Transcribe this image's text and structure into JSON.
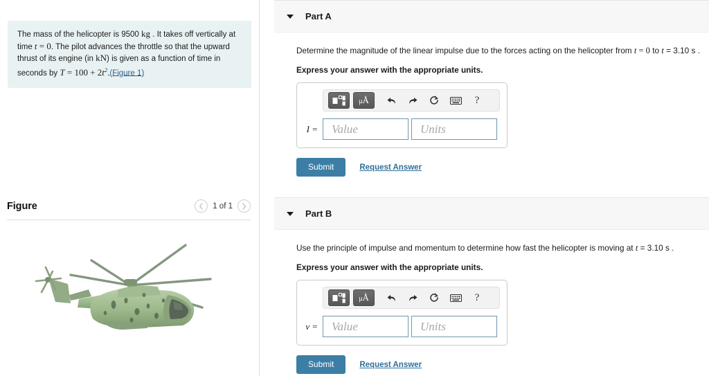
{
  "problem": {
    "text_part1": "The mass of the helicopter is 9500 ",
    "unit_kg": "kg",
    "text_part2": " . It takes off vertically at time ",
    "var_t": "t",
    "eq0": " = 0",
    "text_part3": ". The pilot advances the throttle so that the upward thrust of its engine (in ",
    "unit_kn": "kN",
    "text_part4": ") is given as a function of time in seconds by ",
    "var_T": "T",
    "formula": " = 100 + 2",
    "formula_var": "t",
    "formula_exp": "2",
    "period": ".",
    "figure_link": "(Figure 1)"
  },
  "figure": {
    "title": "Figure",
    "pager_label": "1 of 1",
    "prev_icon": "chevron-left-icon",
    "next_icon": "chevron-right-icon",
    "image_alt": "military green helicopter"
  },
  "toolbar": {
    "template_icon": "math-template-icon",
    "units_icon_mu": "μ",
    "units_icon_a": "Å",
    "undo_icon": "undo-icon",
    "redo_icon": "redo-icon",
    "reset_icon": "reset-icon",
    "keyboard_icon": "keyboard-icon",
    "help_icon": "?"
  },
  "parts": [
    {
      "id": "part-a",
      "title": "Part A",
      "prompt_pre": "Determine the magnitude of the linear impulse due to the forces acting on the helicopter from ",
      "prompt_t1": "t",
      "prompt_eq1": " = 0",
      "prompt_mid": " to ",
      "prompt_t2": "t",
      "prompt_eq2": " = 3.10 s",
      "prompt_post": " .",
      "express": "Express your answer with the appropriate units.",
      "answer_symbol": "I",
      "answer_equals": " =",
      "value_placeholder": "Value",
      "units_placeholder": "Units",
      "submit_label": "Submit",
      "request_label": "Request Answer"
    },
    {
      "id": "part-b",
      "title": "Part B",
      "prompt_pre": "Use the principle of impulse and momentum to determine how fast the helicopter is moving at ",
      "prompt_t1": "t",
      "prompt_eq1": " = 3.10 s",
      "prompt_mid": "",
      "prompt_t2": "",
      "prompt_eq2": "",
      "prompt_post": " .",
      "express": "Express your answer with the appropriate units.",
      "answer_symbol": "v",
      "answer_equals": " =",
      "value_placeholder": "Value",
      "units_placeholder": "Units",
      "submit_label": "Submit",
      "request_label": "Request Answer"
    }
  ],
  "colors": {
    "panel_bg": "#e9f2f3",
    "accent_button": "#3c7ea5",
    "link": "#2f6f99",
    "part_header_bg": "#f7f7f7",
    "field_border": "#6e96ad"
  }
}
